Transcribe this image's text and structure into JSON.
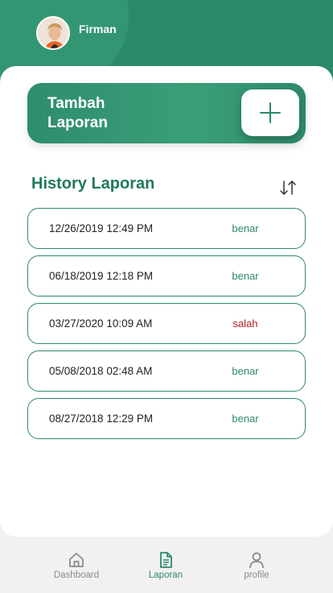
{
  "header": {
    "username": "Firman"
  },
  "add_report": {
    "label": "Tambah Laporan",
    "icon": "plus-icon"
  },
  "history": {
    "title": "History Laporan",
    "sort_icon": "sort-arrows-icon",
    "rows": [
      {
        "datetime": "12/26/2019 12:49 PM",
        "status": "benar",
        "status_color": "#2b8a68"
      },
      {
        "datetime": "06/18/2019 12:18 PM",
        "status": "benar",
        "status_color": "#2b8a68"
      },
      {
        "datetime": "03/27/2020 10:09 AM",
        "status": "salah",
        "status_color": "#b01e1e"
      },
      {
        "datetime": "05/08/2018 02:48 AM",
        "status": "benar",
        "status_color": "#2b8a68"
      },
      {
        "datetime": "08/27/2018 12:29 PM",
        "status": "benar",
        "status_color": "#2b8a68"
      }
    ]
  },
  "bottom_nav": {
    "items": [
      {
        "label": "Dashboard",
        "icon": "home-icon",
        "active": false
      },
      {
        "label": "Laporan",
        "icon": "document-icon",
        "active": true
      },
      {
        "label": "profile",
        "icon": "person-icon",
        "active": false
      }
    ]
  },
  "colors": {
    "primary": "#2b8a68",
    "danger": "#b01e1e",
    "nav_inactive": "#8a8a8a"
  }
}
